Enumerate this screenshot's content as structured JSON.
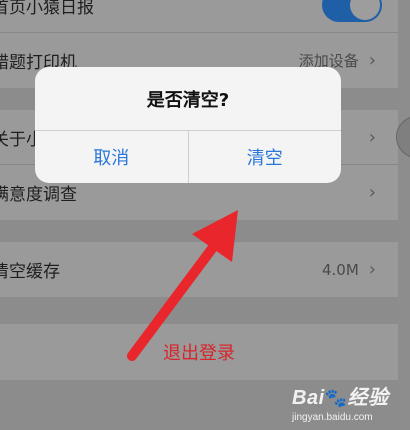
{
  "settings": {
    "rows": [
      {
        "label": "首页小猿日报",
        "type": "toggle"
      },
      {
        "label": "错题打印机",
        "value": "添加设备"
      },
      {
        "label": "关于小",
        "value": ""
      },
      {
        "label": "满意度调查",
        "value": ""
      },
      {
        "label": "清空缓存",
        "value": "4.0M"
      }
    ],
    "chevron": "›",
    "logout": "退出登录"
  },
  "dialog": {
    "title": "是否清空?",
    "cancel": "取消",
    "confirm": "清空"
  },
  "watermark": {
    "brand": "Bai",
    "paw": "🐾",
    "suffix": "经验",
    "url": "jingyan.baidu.com"
  },
  "colors": {
    "accent": "#2b77d9",
    "danger": "#d6262b",
    "annotation_arrow": "#e8262b"
  },
  "icons": {
    "chevron": "chevron-right-icon",
    "annotation": "red-arrow-icon"
  }
}
